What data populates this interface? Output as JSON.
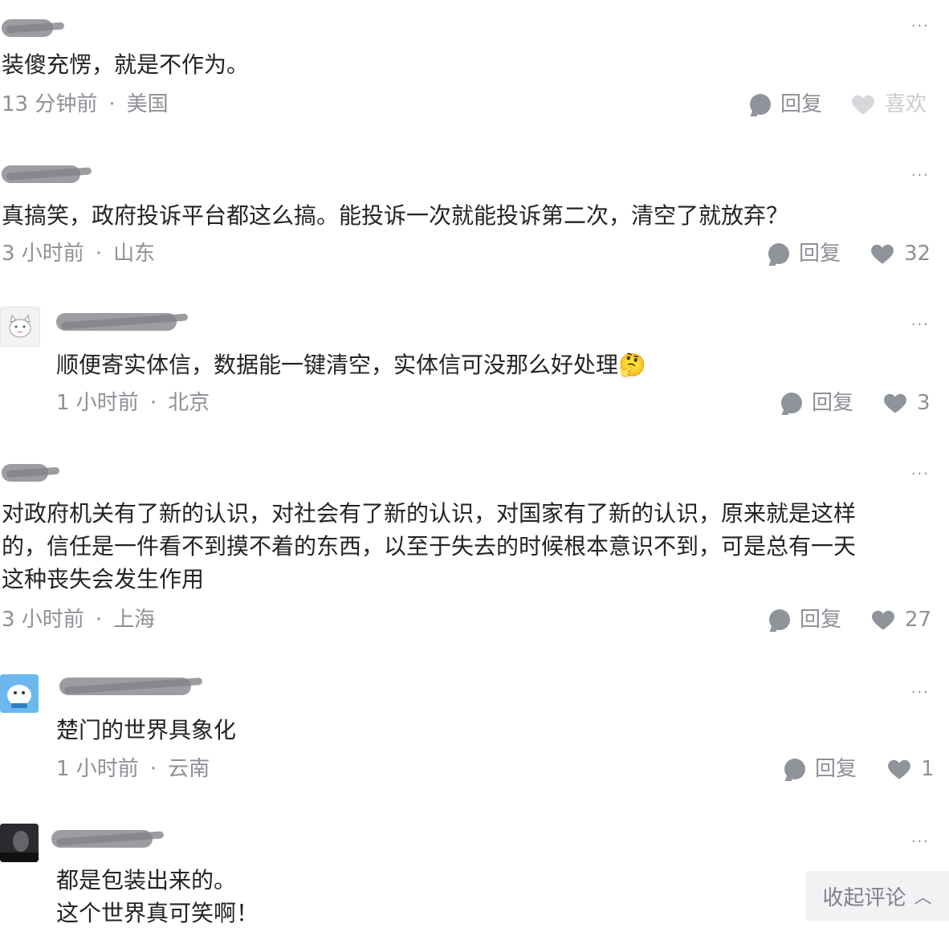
{
  "comments": [
    {
      "text": "装傻充愣，就是不作为。",
      "time": "13 分钟前",
      "location": "美国",
      "reply_label": "回复",
      "like_label": "喜欢"
    },
    {
      "text": "真搞笑，政府投诉平台都这么搞。能投诉一次就能投诉第二次，清空了就放弃？",
      "time": "3 小时前",
      "location": "山东",
      "reply_label": "回复",
      "likes": "32"
    },
    {
      "text": "顺便寄实体信，数据能一键清空，实体信可没那么好处理🤔",
      "time": "1 小时前",
      "location": "北京",
      "reply_label": "回复",
      "likes": "3"
    },
    {
      "text_lines": [
        "对政府机关有了新的认识，对社会有了新的认识，对国家有了新的认识，原来就是这样",
        "的，信任是一件看不到摸不着的东西，以至于失去的时候根本意识不到，可是总有一天",
        "这种丧失会发生作用"
      ],
      "time": "3 小时前",
      "location": "上海",
      "reply_label": "回复",
      "likes": "27"
    },
    {
      "text": "楚门的世界具象化",
      "time": "1 小时前",
      "location": "云南",
      "reply_label": "回复",
      "likes": "1"
    },
    {
      "text_lines": [
        "都是包装出来的。",
        "这个世界真可笑啊！"
      ]
    }
  ],
  "more_glyph": "···",
  "dot": "·",
  "collapse_label": "收起评论",
  "colors": {
    "text": "#222326",
    "meta": "#8d9096",
    "liked_heart": "#8f939a",
    "unliked_heart": "#d6d8dc"
  }
}
